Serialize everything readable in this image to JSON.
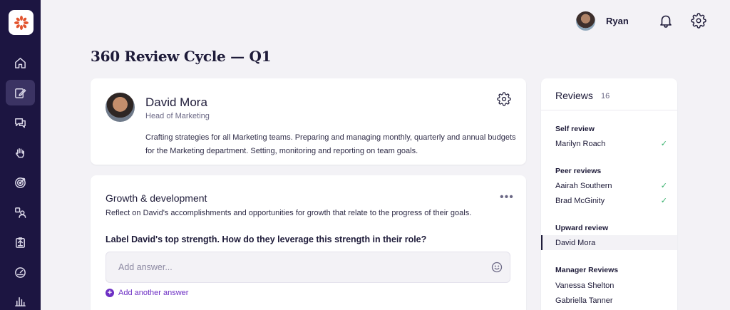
{
  "sidebar": {
    "logo_icon": "brand-logo-icon",
    "items": [
      {
        "icon": "home-icon"
      },
      {
        "icon": "edit-icon",
        "active": true
      },
      {
        "icon": "chat-icon"
      },
      {
        "icon": "hand-icon"
      },
      {
        "icon": "target-icon"
      },
      {
        "icon": "people-icon"
      },
      {
        "icon": "clipboard-icon"
      },
      {
        "icon": "gauge-icon"
      },
      {
        "icon": "chart-icon"
      }
    ]
  },
  "topbar": {
    "user_name": "Ryan"
  },
  "page_title": "360 Review Cycle — Q1",
  "profile": {
    "name": "David Mora",
    "role": "Head of Marketing",
    "description": "Crafting strategies for all Marketing teams. Preparing and managing monthly, quarterly and annual budgets for the Marketing department. Setting, monitoring and reporting on team goals."
  },
  "growth": {
    "title": "Growth & development",
    "more": "•••",
    "subtitle": "Reflect on David's accomplishments and opportunities for growth that relate to the progress of their goals.",
    "question": "Label David's top strength. How do they leverage this strength in their role?",
    "answer_placeholder": "Add answer...",
    "answer_value": "",
    "add_icon": "+",
    "add_label": "Add another answer"
  },
  "reviews": {
    "title": "Reviews",
    "count": "16",
    "check_mark": "✓",
    "groups": [
      {
        "title": "Self review",
        "items": [
          {
            "name": "Marilyn Roach",
            "done": true
          }
        ]
      },
      {
        "title": "Peer reviews",
        "items": [
          {
            "name": "Aairah Southern",
            "done": true
          },
          {
            "name": "Brad McGinity",
            "done": true
          }
        ]
      },
      {
        "title": "Upward review",
        "items": [
          {
            "name": "David Mora",
            "done": false,
            "active": true
          }
        ]
      },
      {
        "title": "Manager Reviews",
        "items": [
          {
            "name": "Vanessa Shelton",
            "done": false
          },
          {
            "name": "Gabriella Tanner",
            "done": false
          }
        ]
      }
    ]
  },
  "colors": {
    "sidebar_bg": "#1c1541",
    "accent": "#6d2fc4",
    "check": "#35b06b",
    "page_bg": "#f3f2f6"
  }
}
